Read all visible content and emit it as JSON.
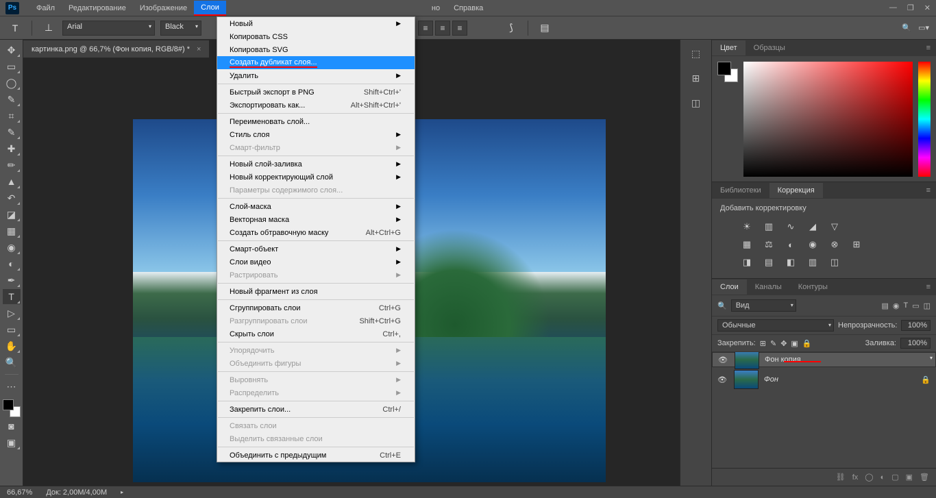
{
  "menubar": {
    "items": [
      "Файл",
      "Редактирование",
      "Изображение",
      "Слои"
    ],
    "right_items": [
      "но",
      "Справка"
    ],
    "highlighted_index": 3
  },
  "window": {
    "min": "—",
    "max": "❐",
    "close": "✕"
  },
  "options": {
    "font": "Arial",
    "color": "Black"
  },
  "doc": {
    "tab": "картинка.png @ 66,7% (Фон копия, RGB/8#) *"
  },
  "dropdown": [
    {
      "t": "item",
      "label": "Новый",
      "arrow": true
    },
    {
      "t": "item",
      "label": "Копировать CSS"
    },
    {
      "t": "item",
      "label": "Копировать SVG"
    },
    {
      "t": "item",
      "label": "Создать дубликат слоя...",
      "hl": true
    },
    {
      "t": "item",
      "label": "Удалить",
      "arrow": true
    },
    {
      "t": "sep"
    },
    {
      "t": "item",
      "label": "Быстрый экспорт в PNG",
      "sc": "Shift+Ctrl+'"
    },
    {
      "t": "item",
      "label": "Экспортировать как...",
      "sc": "Alt+Shift+Ctrl+'"
    },
    {
      "t": "sep"
    },
    {
      "t": "item",
      "label": "Переименовать слой..."
    },
    {
      "t": "item",
      "label": "Стиль слоя",
      "arrow": true
    },
    {
      "t": "item",
      "label": "Смарт-фильтр",
      "arrow": true,
      "dis": true
    },
    {
      "t": "sep"
    },
    {
      "t": "item",
      "label": "Новый слой-заливка",
      "arrow": true
    },
    {
      "t": "item",
      "label": "Новый корректирующий слой",
      "arrow": true
    },
    {
      "t": "item",
      "label": "Параметры содержимого слоя...",
      "dis": true
    },
    {
      "t": "sep"
    },
    {
      "t": "item",
      "label": "Слой-маска",
      "arrow": true
    },
    {
      "t": "item",
      "label": "Векторная маска",
      "arrow": true
    },
    {
      "t": "item",
      "label": "Создать обтравочную маску",
      "sc": "Alt+Ctrl+G"
    },
    {
      "t": "sep"
    },
    {
      "t": "item",
      "label": "Смарт-объект",
      "arrow": true
    },
    {
      "t": "item",
      "label": "Слои видео",
      "arrow": true
    },
    {
      "t": "item",
      "label": "Растрировать",
      "arrow": true,
      "dis": true
    },
    {
      "t": "sep"
    },
    {
      "t": "item",
      "label": "Новый фрагмент из слоя"
    },
    {
      "t": "sep"
    },
    {
      "t": "item",
      "label": "Сгруппировать слои",
      "sc": "Ctrl+G"
    },
    {
      "t": "item",
      "label": "Разгруппировать слои",
      "sc": "Shift+Ctrl+G",
      "dis": true
    },
    {
      "t": "item",
      "label": "Скрыть слои",
      "sc": "Ctrl+,"
    },
    {
      "t": "sep"
    },
    {
      "t": "item",
      "label": "Упорядочить",
      "arrow": true,
      "dis": true
    },
    {
      "t": "item",
      "label": "Объединить фигуры",
      "arrow": true,
      "dis": true
    },
    {
      "t": "sep"
    },
    {
      "t": "item",
      "label": "Выровнять",
      "arrow": true,
      "dis": true
    },
    {
      "t": "item",
      "label": "Распределить",
      "arrow": true,
      "dis": true
    },
    {
      "t": "sep"
    },
    {
      "t": "item",
      "label": "Закрепить слои...",
      "sc": "Ctrl+/"
    },
    {
      "t": "sep"
    },
    {
      "t": "item",
      "label": "Связать слои",
      "dis": true
    },
    {
      "t": "item",
      "label": "Выделить связанные слои",
      "dis": true
    },
    {
      "t": "sep"
    },
    {
      "t": "item",
      "label": "Объединить с предыдущим",
      "sc": "Ctrl+E"
    }
  ],
  "panels": {
    "color_tabs": [
      "Цвет",
      "Образцы"
    ],
    "adj_tabs": [
      "Библиотеки",
      "Коррекция"
    ],
    "adj_label": "Добавить корректировку",
    "layer_tabs": [
      "Слои",
      "Каналы",
      "Контуры"
    ],
    "kind": "Вид",
    "blend": "Обычные",
    "opacity_label": "Непрозрачность:",
    "opacity": "100%",
    "lock_label": "Закрепить:",
    "fill_label": "Заливка:",
    "fill": "100%",
    "search_icon": "🔍",
    "layers": [
      {
        "name": "Фон копия",
        "selected": true,
        "redline": true
      },
      {
        "name": "Фон",
        "locked": true
      }
    ]
  },
  "status": {
    "zoom": "66,67%",
    "doc": "Док: 2,00M/4,00M"
  }
}
